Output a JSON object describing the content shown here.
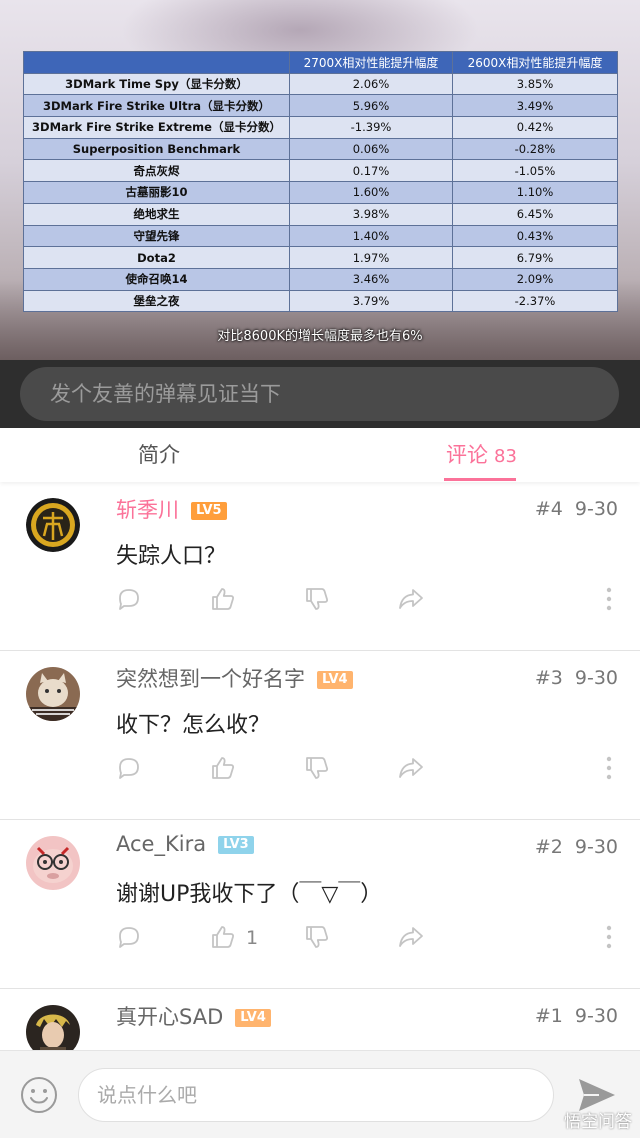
{
  "video": {
    "table": {
      "headers": [
        "",
        "2700X相对性能提升幅度",
        "2600X相对性能提升幅度"
      ],
      "rows": [
        {
          "name": "3DMark Time Spy（显卡分数）",
          "v2700": "2.06%",
          "v2600": "3.85%"
        },
        {
          "name": "3DMark Fire Strike Ultra（显卡分数）",
          "v2700": "5.96%",
          "v2600": "3.49%"
        },
        {
          "name": "3DMark Fire Strike Extreme（显卡分数）",
          "v2700": "-1.39%",
          "v2600": "0.42%"
        },
        {
          "name": "Superposition Benchmark",
          "v2700": "0.06%",
          "v2600": "-0.28%"
        },
        {
          "name": "奇点灰烬",
          "v2700": "0.17%",
          "v2600": "-1.05%"
        },
        {
          "name": "古墓丽影10",
          "v2700": "1.60%",
          "v2600": "1.10%"
        },
        {
          "name": "绝地求生",
          "v2700": "3.98%",
          "v2600": "6.45%"
        },
        {
          "name": "守望先锋",
          "v2700": "1.40%",
          "v2600": "0.43%"
        },
        {
          "name": "Dota2",
          "v2700": "1.97%",
          "v2600": "6.79%"
        },
        {
          "name": "使命召唤14",
          "v2700": "3.46%",
          "v2600": "2.09%"
        },
        {
          "name": "堡垒之夜",
          "v2700": "3.79%",
          "v2600": "-2.37%"
        }
      ]
    },
    "subtitle": "对比8600K的增长幅度最多也有6%"
  },
  "danmaku": {
    "placeholder": "发个友善的弹幕见证当下"
  },
  "tabs": {
    "intro": "简介",
    "comments": "评论",
    "comments_count": "83"
  },
  "comments": [
    {
      "user": "斩季川",
      "level": "LV5",
      "floor": "#4",
      "date": "9-30",
      "text": "失踪人口？",
      "likes": ""
    },
    {
      "user": "突然想到一个好名字",
      "level": "LV4",
      "floor": "#3",
      "date": "9-30",
      "text": "收下？怎么收？",
      "likes": ""
    },
    {
      "user": "Ace_Kira",
      "level": "LV3",
      "floor": "#2",
      "date": "9-30",
      "text": "谢谢UP我收下了（￣▽￣）",
      "likes": "1"
    },
    {
      "user": "真开心SAD",
      "level": "LV4",
      "floor": "#1",
      "date": "9-30",
      "text": "",
      "likes": ""
    }
  ],
  "bottom": {
    "placeholder": "说点什么吧"
  },
  "watermark": "悟空问答",
  "colors": {
    "accent": "#fb7299",
    "table_header": "#3e66b8",
    "danmaku_bar": "#2e2e2e"
  },
  "icons": [
    "reply-icon",
    "like-icon",
    "dislike-icon",
    "share-icon",
    "more-icon",
    "emoji-icon",
    "send-icon"
  ]
}
